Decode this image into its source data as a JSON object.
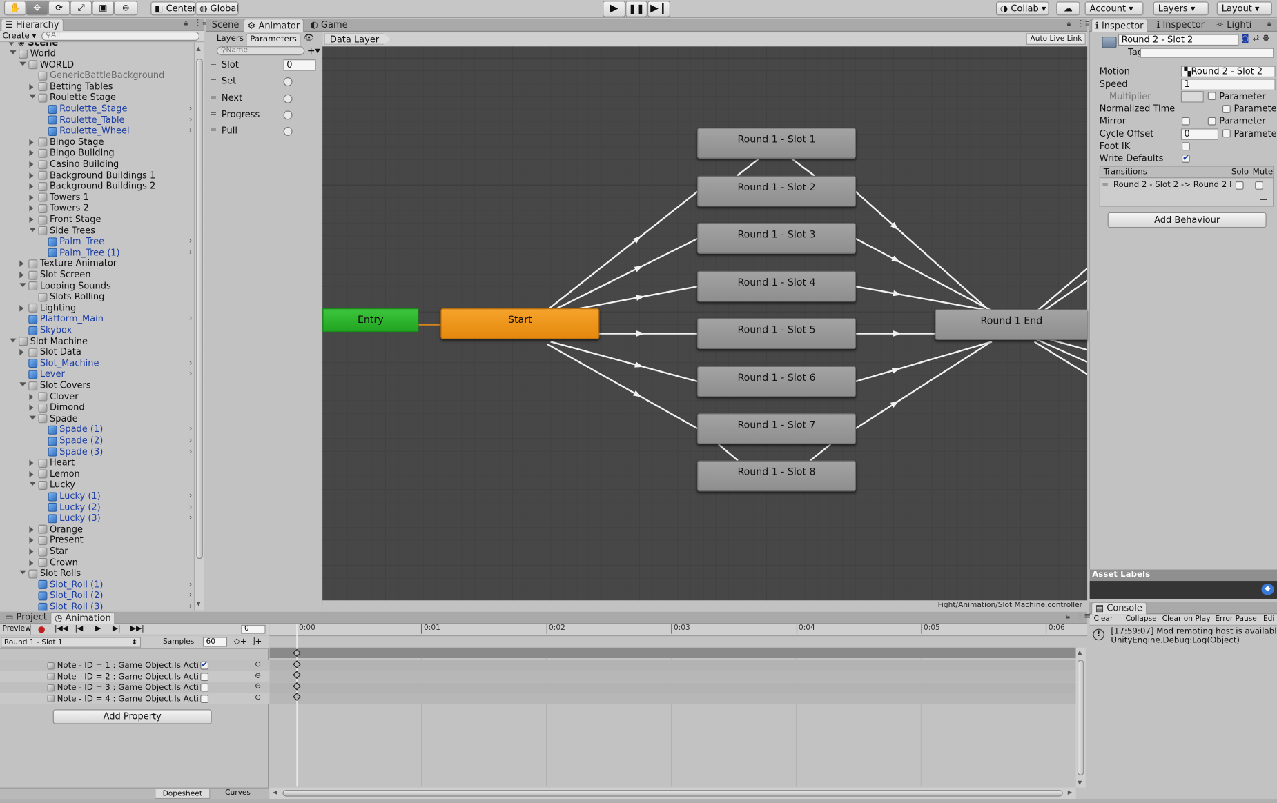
{
  "toolbar": {
    "pivot_label": "Center",
    "space_label": "Global",
    "collab_label": "Collab",
    "account_label": "Account",
    "layers_label": "Layers",
    "layout_label": "Layout"
  },
  "hierarchy": {
    "tab_label": "Hierarchy",
    "create_label": "Create",
    "search_placeholder": "All",
    "scene_label": "Scene",
    "items": [
      {
        "label": "World",
        "depth": 0,
        "expand": "down",
        "icon": "gray",
        "style": "normal",
        "chevron": false
      },
      {
        "label": "WORLD",
        "depth": 1,
        "expand": "down",
        "icon": "gray",
        "style": "normal",
        "chevron": false
      },
      {
        "label": "GenericBattleBackground",
        "depth": 2,
        "expand": "none",
        "icon": "gray",
        "style": "gray",
        "chevron": false
      },
      {
        "label": "Betting Tables",
        "depth": 2,
        "expand": "right",
        "icon": "gray",
        "style": "normal",
        "chevron": false
      },
      {
        "label": "Roulette Stage",
        "depth": 2,
        "expand": "down",
        "icon": "gray",
        "style": "normal",
        "chevron": false
      },
      {
        "label": "Roulette_Stage",
        "depth": 3,
        "expand": "none",
        "icon": "blue",
        "style": "blue",
        "chevron": true
      },
      {
        "label": "Roulette_Table",
        "depth": 3,
        "expand": "none",
        "icon": "blue",
        "style": "blue",
        "chevron": true
      },
      {
        "label": "Roulette_Wheel",
        "depth": 3,
        "expand": "none",
        "icon": "blue",
        "style": "blue",
        "chevron": true
      },
      {
        "label": "Bingo Stage",
        "depth": 2,
        "expand": "right",
        "icon": "gray",
        "style": "normal",
        "chevron": false
      },
      {
        "label": "Bingo Building",
        "depth": 2,
        "expand": "right",
        "icon": "gray",
        "style": "normal",
        "chevron": false
      },
      {
        "label": "Casino Building",
        "depth": 2,
        "expand": "right",
        "icon": "gray",
        "style": "normal",
        "chevron": false
      },
      {
        "label": "Background Buildings 1",
        "depth": 2,
        "expand": "right",
        "icon": "gray",
        "style": "normal",
        "chevron": false
      },
      {
        "label": "Background Buildings 2",
        "depth": 2,
        "expand": "right",
        "icon": "gray",
        "style": "normal",
        "chevron": false
      },
      {
        "label": "Towers 1",
        "depth": 2,
        "expand": "right",
        "icon": "gray",
        "style": "normal",
        "chevron": false
      },
      {
        "label": "Towers 2",
        "depth": 2,
        "expand": "right",
        "icon": "gray",
        "style": "normal",
        "chevron": false
      },
      {
        "label": "Front Stage",
        "depth": 2,
        "expand": "right",
        "icon": "gray",
        "style": "normal",
        "chevron": false
      },
      {
        "label": "Side Trees",
        "depth": 2,
        "expand": "down",
        "icon": "gray",
        "style": "normal",
        "chevron": false
      },
      {
        "label": "Palm_Tree",
        "depth": 3,
        "expand": "none",
        "icon": "blue",
        "style": "blue",
        "chevron": true
      },
      {
        "label": "Palm_Tree (1)",
        "depth": 3,
        "expand": "none",
        "icon": "blue",
        "style": "blue",
        "chevron": true
      },
      {
        "label": "Texture Animator",
        "depth": 1,
        "expand": "right",
        "icon": "gray",
        "style": "normal",
        "chevron": false
      },
      {
        "label": "Slot Screen",
        "depth": 1,
        "expand": "right",
        "icon": "gray",
        "style": "normal",
        "chevron": false
      },
      {
        "label": "Looping Sounds",
        "depth": 1,
        "expand": "down",
        "icon": "gray",
        "style": "normal",
        "chevron": false
      },
      {
        "label": "Slots Rolling",
        "depth": 2,
        "expand": "none",
        "icon": "gray",
        "style": "normal",
        "chevron": false
      },
      {
        "label": "Lighting",
        "depth": 1,
        "expand": "right",
        "icon": "gray",
        "style": "normal",
        "chevron": false
      },
      {
        "label": "Platform_Main",
        "depth": 1,
        "expand": "none",
        "icon": "blue",
        "style": "blue",
        "chevron": true
      },
      {
        "label": "Skybox",
        "depth": 1,
        "expand": "none",
        "icon": "blue",
        "style": "blue",
        "chevron": false
      },
      {
        "label": "Slot Machine",
        "depth": 0,
        "expand": "down",
        "icon": "gray",
        "style": "normal",
        "chevron": false
      },
      {
        "label": "Slot Data",
        "depth": 1,
        "expand": "right",
        "icon": "gray",
        "style": "normal",
        "chevron": false
      },
      {
        "label": "Slot_Machine",
        "depth": 1,
        "expand": "none",
        "icon": "blue",
        "style": "blue",
        "chevron": true
      },
      {
        "label": "Lever",
        "depth": 1,
        "expand": "none",
        "icon": "blue",
        "style": "blue",
        "chevron": true
      },
      {
        "label": "Slot Covers",
        "depth": 1,
        "expand": "down",
        "icon": "gray",
        "style": "normal",
        "chevron": false
      },
      {
        "label": "Clover",
        "depth": 2,
        "expand": "right",
        "icon": "gray",
        "style": "normal",
        "chevron": false
      },
      {
        "label": "Dimond",
        "depth": 2,
        "expand": "right",
        "icon": "gray",
        "style": "normal",
        "chevron": false
      },
      {
        "label": "Spade",
        "depth": 2,
        "expand": "down",
        "icon": "gray",
        "style": "normal",
        "chevron": false
      },
      {
        "label": "Spade (1)",
        "depth": 3,
        "expand": "none",
        "icon": "blue",
        "style": "blue",
        "chevron": true
      },
      {
        "label": "Spade (2)",
        "depth": 3,
        "expand": "none",
        "icon": "blue",
        "style": "blue",
        "chevron": true
      },
      {
        "label": "Spade (3)",
        "depth": 3,
        "expand": "none",
        "icon": "blue",
        "style": "blue",
        "chevron": true
      },
      {
        "label": "Heart",
        "depth": 2,
        "expand": "right",
        "icon": "gray",
        "style": "normal",
        "chevron": false
      },
      {
        "label": "Lemon",
        "depth": 2,
        "expand": "right",
        "icon": "gray",
        "style": "normal",
        "chevron": false
      },
      {
        "label": "Lucky",
        "depth": 2,
        "expand": "down",
        "icon": "gray",
        "style": "normal",
        "chevron": false
      },
      {
        "label": "Lucky (1)",
        "depth": 3,
        "expand": "none",
        "icon": "blue",
        "style": "blue",
        "chevron": true
      },
      {
        "label": "Lucky (2)",
        "depth": 3,
        "expand": "none",
        "icon": "blue",
        "style": "blue",
        "chevron": true
      },
      {
        "label": "Lucky (3)",
        "depth": 3,
        "expand": "none",
        "icon": "blue",
        "style": "blue",
        "chevron": true
      },
      {
        "label": "Orange",
        "depth": 2,
        "expand": "right",
        "icon": "gray",
        "style": "normal",
        "chevron": false
      },
      {
        "label": "Present",
        "depth": 2,
        "expand": "right",
        "icon": "gray",
        "style": "normal",
        "chevron": false
      },
      {
        "label": "Star",
        "depth": 2,
        "expand": "right",
        "icon": "gray",
        "style": "normal",
        "chevron": false
      },
      {
        "label": "Crown",
        "depth": 2,
        "expand": "right",
        "icon": "gray",
        "style": "normal",
        "chevron": false
      },
      {
        "label": "Slot Rolls",
        "depth": 1,
        "expand": "down",
        "icon": "gray",
        "style": "normal",
        "chevron": false
      },
      {
        "label": "Slot_Roll (1)",
        "depth": 2,
        "expand": "none",
        "icon": "blue",
        "style": "blue",
        "chevron": true
      },
      {
        "label": "Slot_Roll (2)",
        "depth": 2,
        "expand": "none",
        "icon": "blue",
        "style": "blue",
        "chevron": true
      },
      {
        "label": "Slot_Roll (3)",
        "depth": 2,
        "expand": "none",
        "icon": "blue",
        "style": "blue",
        "chevron": true
      }
    ]
  },
  "center_tabs": {
    "scene_label": "Scene",
    "animator_label": "Animator",
    "game_label": "Game"
  },
  "animator": {
    "layers_tab": "Layers",
    "parameters_tab": "Parameters",
    "name_placeholder": "Name",
    "breadcrumb": "Data Layer",
    "auto_live_link": "Auto Live Link",
    "path": "Fight/Animation/Slot Machine.controller",
    "parameters": [
      {
        "name": "Slot",
        "type": "int",
        "value": "0"
      },
      {
        "name": "Set",
        "type": "trigger"
      },
      {
        "name": "Next",
        "type": "trigger"
      },
      {
        "name": "Progress",
        "type": "trigger"
      },
      {
        "name": "Pull",
        "type": "trigger"
      }
    ],
    "entry_label": "Entry",
    "start_label": "Start",
    "end_label": "Round 1 End",
    "slots": [
      "Round 1 - Slot 1",
      "Round 1 - Slot 2",
      "Round 1 - Slot 3",
      "Round 1 - Slot 4",
      "Round 1 - Slot 5",
      "Round 1 - Slot 6",
      "Round 1 - Slot 7",
      "Round 1 - Slot 8"
    ]
  },
  "inspector": {
    "tab1": "Inspector",
    "tab2": "Inspector",
    "tab3": "Lighti",
    "state_name": "Round 2 - Slot 2",
    "tag_label": "Tag",
    "motion_label": "Motion",
    "motion_value": "Round 2 - Slot 2",
    "speed_label": "Speed",
    "speed_value": "1",
    "multiplier_label": "Multiplier",
    "parameter_label": "Parameter",
    "normalized_time_label": "Normalized Time",
    "mirror_label": "Mirror",
    "cycle_offset_label": "Cycle Offset",
    "cycle_offset_value": "0",
    "foot_ik_label": "Foot IK",
    "write_defaults_label": "Write Defaults",
    "transitions_label": "Transitions",
    "solo_label": "Solo",
    "mute_label": "Mute",
    "transition_item": "Round 2 - Slot 2 -> Round 2 I",
    "add_behaviour_label": "Add Behaviour",
    "asset_labels": "Asset Labels"
  },
  "console": {
    "tab_label": "Console",
    "clear": "Clear",
    "collapse": "Collapse",
    "clear_on_play": "Clear on Play",
    "error_pause": "Error Pause",
    "edit": "Edi",
    "message_line1": "[17:59:07] Mod remoting host is available",
    "message_line2": "UnityEngine.Debug:Log(Object)"
  },
  "animation": {
    "project_tab": "Project",
    "animation_tab": "Animation",
    "preview_label": "Preview",
    "frame_value": "0",
    "clip_name": "Round 1 - Slot 1",
    "samples_label": "Samples",
    "samples_value": "60",
    "properties": [
      {
        "label": "Note - ID = 1 : Game Object.Is Acti",
        "checked": true
      },
      {
        "label": "Note - ID = 2 : Game Object.Is Acti",
        "checked": false
      },
      {
        "label": "Note - ID = 3 : Game Object.Is Acti",
        "checked": false
      },
      {
        "label": "Note - ID = 4 : Game Object.Is Acti",
        "checked": false
      }
    ],
    "add_property_label": "Add Property",
    "dopesheet_label": "Dopesheet",
    "curves_label": "Curves",
    "ticks": [
      "0:00",
      "0:01",
      "0:02",
      "0:03",
      "0:04",
      "0:05",
      "0:06"
    ]
  },
  "colors": {
    "entry": "#2fb52f",
    "start": "#f09a1b",
    "graph_bg": "#474747",
    "blue_link": "#1d3fa5"
  }
}
